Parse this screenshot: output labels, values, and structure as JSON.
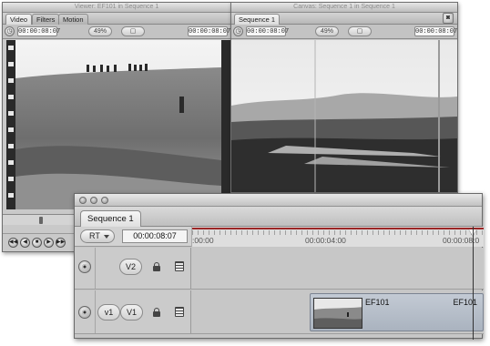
{
  "viewer": {
    "title": "Viewer: EF101 in Sequence 1",
    "tabs": [
      "Video",
      "Filters",
      "Motion"
    ],
    "duration": "00:00:08:07",
    "zoom": "49%",
    "view_mode": "▢",
    "timecode": "00:00:08:07",
    "transport": [
      "◀◀",
      "◀",
      "■",
      "▶",
      "▶▶"
    ]
  },
  "canvas": {
    "title": "Canvas: Sequence 1 in Sequence 1",
    "tab": "Sequence 1",
    "duration": "00:00:08:07",
    "zoom": "49%",
    "view_mode": "▢",
    "timecode": "00:00:08:07"
  },
  "timeline": {
    "tab": "Sequence 1",
    "rt_label": "RT",
    "timecode": "00:00:08:07",
    "ruler_labels": [
      ":00:00",
      "00:00:04:00",
      "00:00:08:0"
    ],
    "tracks": [
      {
        "source_label": "",
        "dest_label": "V2",
        "clips": []
      },
      {
        "source_label": "v1",
        "dest_label": "V1",
        "clips": [
          {
            "name_start": "EF101",
            "name_end": "EF101"
          }
        ]
      }
    ]
  },
  "colors": {
    "playhead_bar": "#9b2626",
    "clip_fill": "#b8c0cb"
  },
  "icons": [
    "visibility-toggle-icon",
    "lock-icon",
    "film-strip-icon",
    "playhead-icon"
  ]
}
